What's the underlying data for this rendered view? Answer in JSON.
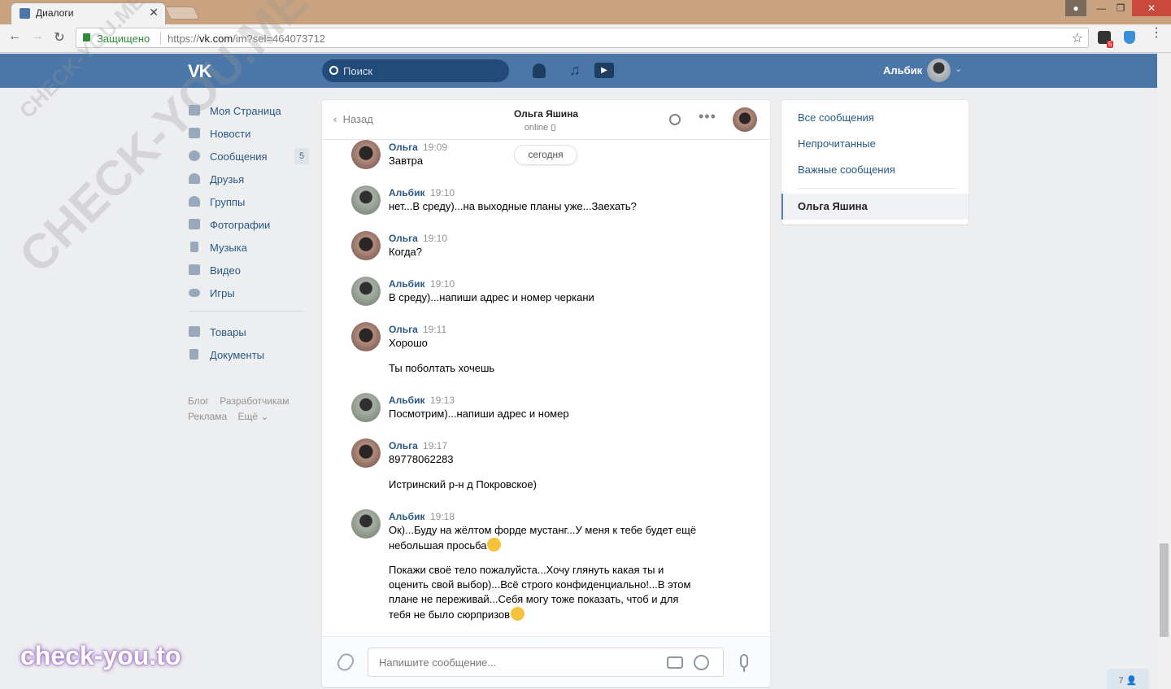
{
  "browser": {
    "tab_title": "Диалоги",
    "secure_label": "Защищено",
    "url_prefix": "https://",
    "url_host": "vk.com",
    "url_path": "/im?sel=464073712",
    "ext_badge": "5"
  },
  "header": {
    "logo": "VK",
    "search_placeholder": "Поиск",
    "user_name": "Альбик"
  },
  "nav": {
    "items": [
      {
        "label": "Моя Страница",
        "icon": "home-icon"
      },
      {
        "label": "Новости",
        "icon": "news-icon"
      },
      {
        "label": "Сообщения",
        "icon": "messages-icon",
        "badge": "5"
      },
      {
        "label": "Друзья",
        "icon": "friends-icon"
      },
      {
        "label": "Группы",
        "icon": "groups-icon"
      },
      {
        "label": "Фотографии",
        "icon": "camera-icon"
      },
      {
        "label": "Музыка",
        "icon": "music-icon"
      },
      {
        "label": "Видео",
        "icon": "video-icon"
      },
      {
        "label": "Игры",
        "icon": "games-icon"
      }
    ],
    "items2": [
      {
        "label": "Товары",
        "icon": "bag-icon"
      },
      {
        "label": "Документы",
        "icon": "document-icon"
      }
    ],
    "footer": [
      "Блог",
      "Разработчикам",
      "Реклама",
      "Ещё ⌄"
    ]
  },
  "chat": {
    "back_label": "Назад",
    "title": "Ольга Яшина",
    "status": "online",
    "today_label": "сегодня",
    "messages": [
      {
        "author": "Ольга",
        "time": "19:09",
        "lines": [
          "Завтра"
        ]
      },
      {
        "author": "Альбик",
        "time": "19:10",
        "lines": [
          "нет...В среду)...на выходные планы уже...Заехать?"
        ]
      },
      {
        "author": "Ольга",
        "time": "19:10",
        "lines": [
          "Когда?"
        ]
      },
      {
        "author": "Альбик",
        "time": "19:10",
        "lines": [
          "В среду)...напиши адрес и номер черкани"
        ]
      },
      {
        "author": "Ольга",
        "time": "19:11",
        "lines": [
          "Хорошо",
          "Ты поболтать хочешь"
        ]
      },
      {
        "author": "Альбик",
        "time": "19:13",
        "lines": [
          "Посмотрим)...напиши адрес и номер"
        ]
      },
      {
        "author": "Ольга",
        "time": "19:17",
        "lines": [
          "89778062283",
          "Истринский р-н д Покровское)"
        ]
      },
      {
        "author": "Альбик",
        "time": "19:18",
        "lines": [
          "Ок)...Буду на жёлтом форде мустанг...У меня к тебе будет ещё небольшая просьба",
          "Покажи своё тело пожалуйста...Хочу глянуть какая ты и оценить свой выбор)...Всё строго конфиденциально!...В этом плане не переживай...Себя могу тоже показать, чтоб и для тебя не было сюрпризов"
        ]
      }
    ],
    "input_placeholder": "Напишите сообщение..."
  },
  "right_panel": {
    "filters": [
      "Все сообщения",
      "Непрочитанные",
      "Важные сообщения"
    ],
    "active_dialog": "Ольга Яшина"
  },
  "online_count": "7",
  "watermark": {
    "large": "CHECK-YOU.ME",
    "small": "CHECK-YOU.ME",
    "brand": "check-you.to"
  },
  "colors": {
    "vk_blue": "#4a76a8",
    "link": "#2a5885",
    "page_bg": "#edeef0"
  }
}
